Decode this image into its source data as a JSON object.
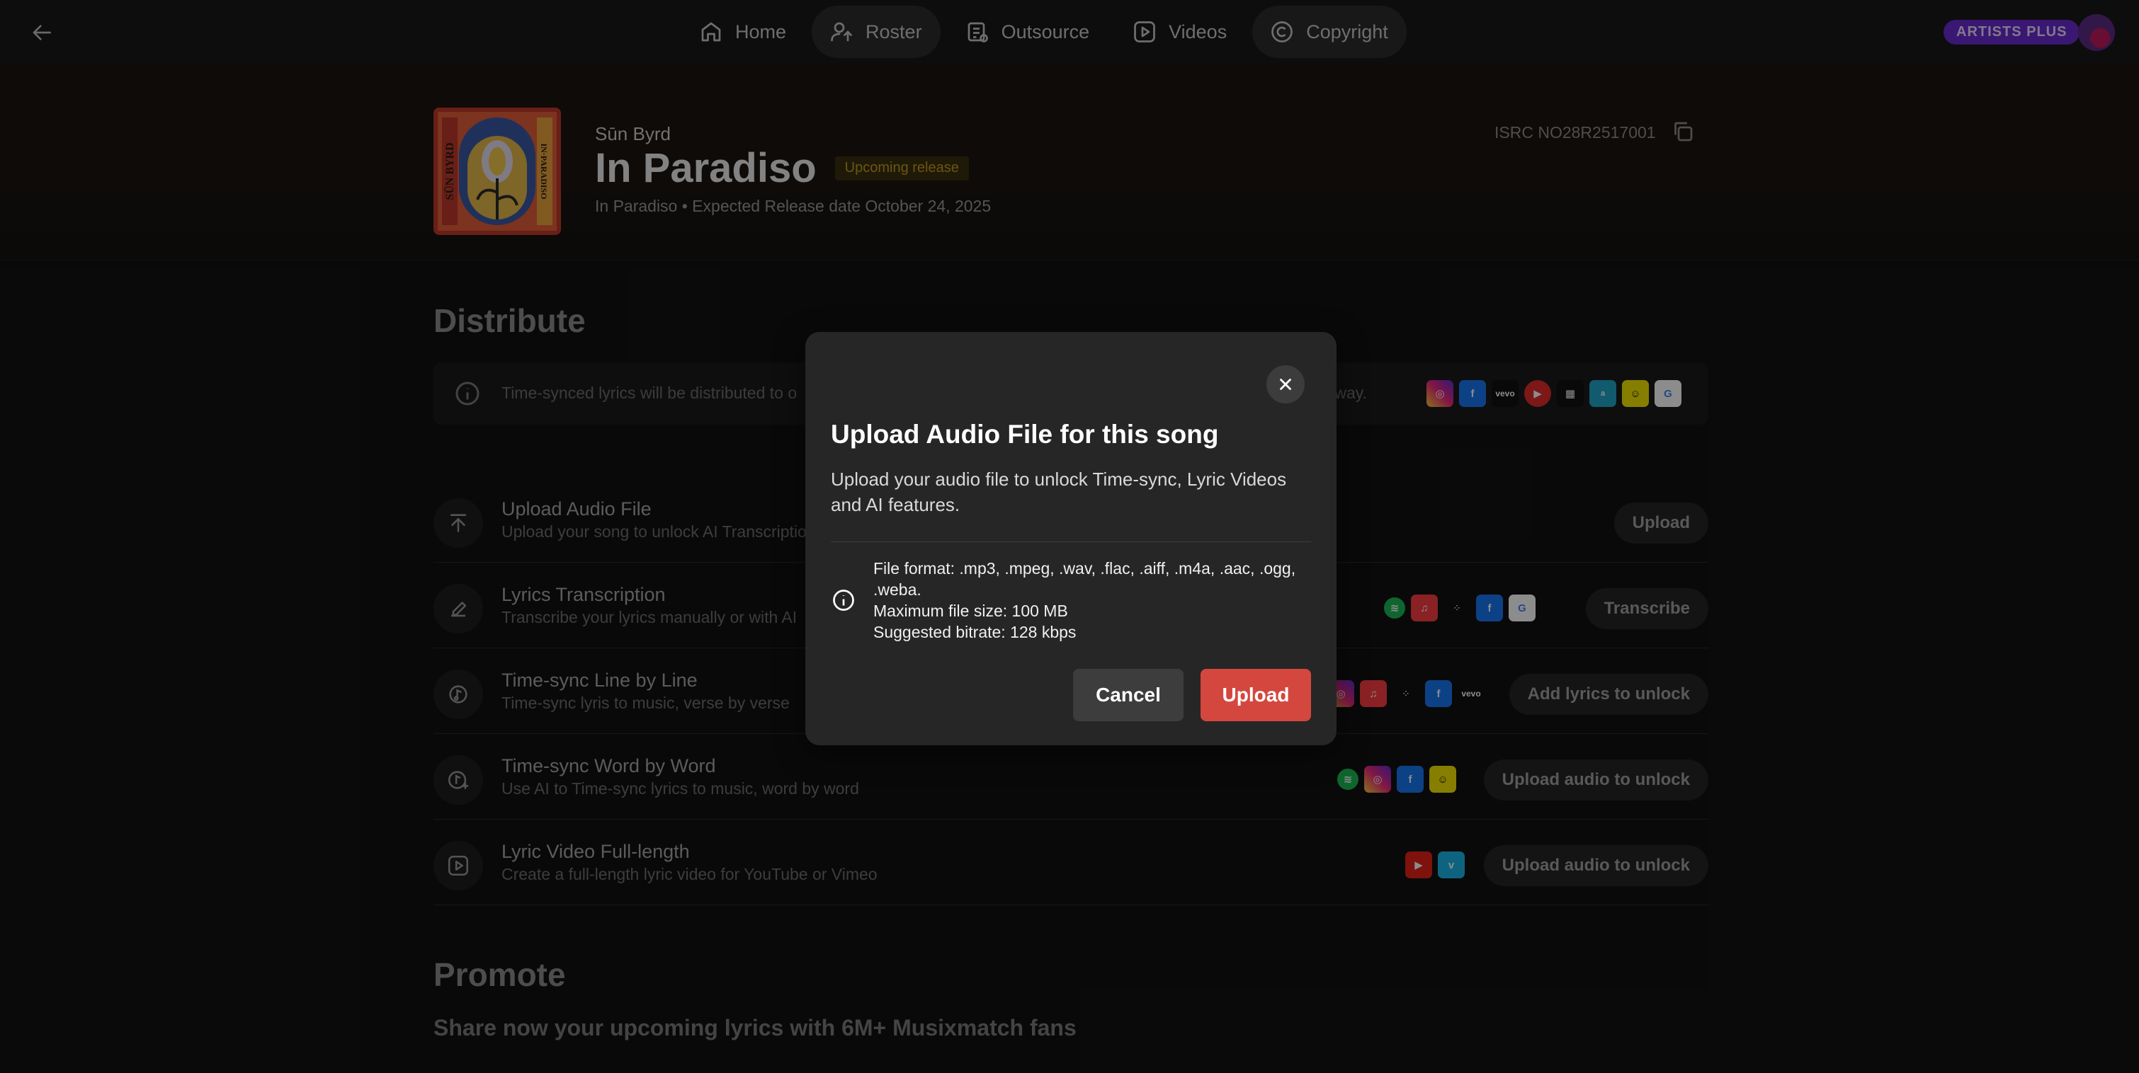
{
  "nav": {
    "items": [
      {
        "label": "Home",
        "icon": "home-icon",
        "active": false
      },
      {
        "label": "Roster",
        "icon": "roster-icon",
        "active": true
      },
      {
        "label": "Outsource",
        "icon": "outsource-icon",
        "active": false
      },
      {
        "label": "Videos",
        "icon": "play-icon",
        "active": false
      },
      {
        "label": "Copyright",
        "icon": "copyright-icon",
        "active": true
      }
    ],
    "plan_badge": "ARTISTS PLUS"
  },
  "header": {
    "artist": "Sūn Byrd",
    "title": "In Paradiso",
    "status_badge": "Upcoming release",
    "release_line": "In Paradiso • Expected Release date October 24, 2025",
    "isrc": "ISRC NO28R2517001",
    "cover_text_left": "SŪN BYRD",
    "cover_text_right": "IN·PARADISO"
  },
  "distribute": {
    "title": "Distribute",
    "info_text": "Time-synced lyrics will be distributed to o",
    "info_tail": "nt away.",
    "info_platforms": [
      "instagram",
      "facebook",
      "vevo",
      "youtube-music",
      "windows",
      "amazon",
      "snapchat",
      "google"
    ],
    "rows": [
      {
        "title": "Upload Audio File",
        "subtitle": "Upload your song to unlock AI Transcriptio",
        "button": "Upload",
        "icon": "upload-icon",
        "platforms": []
      },
      {
        "title": "Lyrics Transcription",
        "subtitle": "Transcribe your lyrics manually or with AI",
        "button": "Transcribe",
        "icon": "pencil-icon",
        "platforms": [
          "spotify",
          "apple-music",
          "tidal",
          "facebook",
          "google"
        ]
      },
      {
        "title": "Time-sync Line by Line",
        "subtitle": "Time-sync lyris to music, verse by verse",
        "button": "Add lyrics to unlock",
        "icon": "music-sync-icon",
        "platforms": [
          "instagram",
          "apple-music",
          "tidal",
          "facebook",
          "vevo"
        ]
      },
      {
        "title": "Time-sync Word by Word",
        "subtitle": "Use AI to Time-sync lyrics to music, word by word",
        "button": "Upload audio to unlock",
        "icon": "music-ai-icon",
        "platforms": [
          "spotify",
          "instagram",
          "facebook",
          "snapchat"
        ]
      },
      {
        "title": "Lyric Video Full-length",
        "subtitle": "Create a full-length lyric video for YouTube or Vimeo",
        "button": "Upload audio to unlock",
        "icon": "video-icon",
        "platforms": [
          "youtube",
          "vimeo"
        ]
      }
    ]
  },
  "promote": {
    "title": "Promote",
    "subtitle": "Share now your upcoming lyrics with 6M+ Musixmatch fans"
  },
  "modal": {
    "title": "Upload Audio File for this song",
    "description": "Upload your audio file to unlock Time-sync, Lyric Videos and AI features.",
    "formats": "File format: .mp3, .mpeg, .wav, .flac, .aiff, .m4a, .aac, .ogg, .weba.",
    "max_size": "Maximum file size: 100 MB",
    "bitrate": "Suggested bitrate: 128 kbps",
    "cancel_label": "Cancel",
    "upload_label": "Upload"
  },
  "colors": {
    "accent_red": "#d4473e",
    "plan_purple": "#6b2bd1",
    "badge_gold": "#c79a22"
  }
}
